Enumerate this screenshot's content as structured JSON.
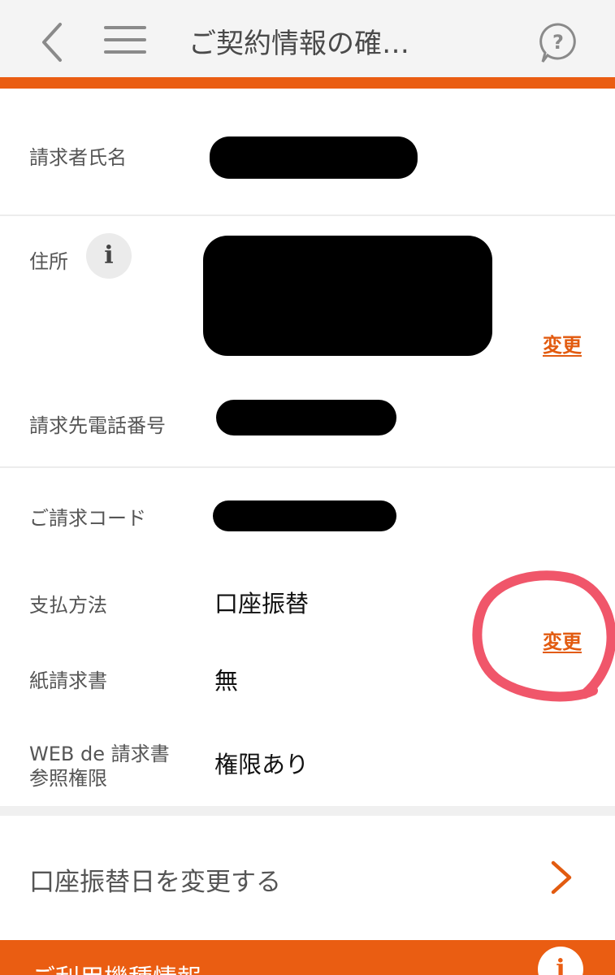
{
  "header": {
    "title": "ご契約情報の確…",
    "back_icon": "chevron-left-icon",
    "menu_icon": "hamburger-menu-icon",
    "help_icon": "help-bubble-icon"
  },
  "billing": {
    "billing_name_label": "請求者氏名",
    "address_label": "住所",
    "address_info_icon": "i",
    "address_change": "変更",
    "phone_label": "請求先電話番号"
  },
  "payment": {
    "code_label": "ご請求コード",
    "method_label": "支払方法",
    "method_value": "口座振替",
    "method_change": "変更",
    "paper_label": "紙請求書",
    "paper_value": "無",
    "web_label_line1": "WEB de 請求書",
    "web_label_line2": "参照権限",
    "web_value": "権限あり"
  },
  "link_row": {
    "label": "口座振替日を変更する"
  },
  "footer": {
    "title": "ご利用機種情報",
    "info_icon": "i"
  },
  "colors": {
    "accent": "#ea5d12",
    "annotation": "#f0566a"
  }
}
